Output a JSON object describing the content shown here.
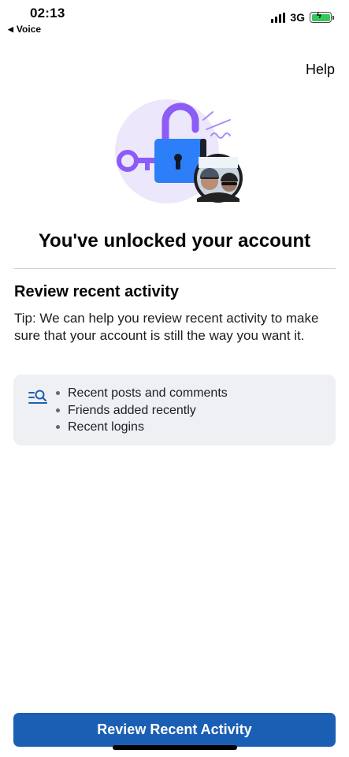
{
  "status_bar": {
    "time": "02:13",
    "back_label": "Voice",
    "network": "3G",
    "battery_charging": true
  },
  "header": {
    "help_label": "Help"
  },
  "illustration": {
    "icons": [
      "lock-icon",
      "key-icon",
      "avatar"
    ],
    "colors": {
      "lock": "#2d7ff9",
      "shackle": "#8b5cf6",
      "key": "#8b5cf6",
      "bg_circle": "#ede7fb"
    }
  },
  "main": {
    "title": "You've unlocked your account",
    "section_heading": "Review recent activity",
    "tip": "Tip: We can help you review recent activity to make sure that your account is still the way you want it.",
    "card_items": [
      "Recent posts and comments",
      "Friends added recently",
      "Recent logins"
    ],
    "card_icon": "search-list-icon"
  },
  "footer": {
    "button_label": "Review Recent Activity",
    "button_color": "#1b5fb4"
  }
}
